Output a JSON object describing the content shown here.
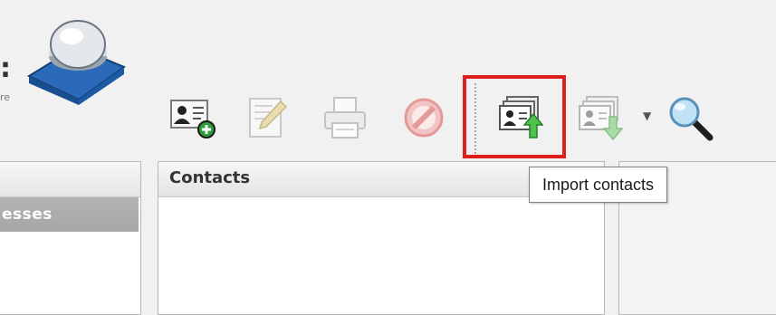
{
  "header": {
    "logo_text_fragment": ":",
    "logo_subtext_fragment": "re"
  },
  "toolbar": {
    "buttons": [
      {
        "name": "add-contact",
        "icon": "add-contact-icon",
        "enabled": true
      },
      {
        "name": "edit-contact",
        "icon": "pencil-icon",
        "enabled": false
      },
      {
        "name": "print-contact",
        "icon": "printer-icon",
        "enabled": false
      },
      {
        "name": "delete-contact",
        "icon": "delete-icon",
        "enabled": false
      },
      {
        "name": "import-contacts",
        "icon": "import-contacts-icon",
        "enabled": true,
        "highlighted": true
      },
      {
        "name": "export-contacts",
        "icon": "export-contacts-icon",
        "enabled": false,
        "has_dropdown": true
      },
      {
        "name": "search",
        "icon": "magnifier-icon",
        "enabled": true
      }
    ],
    "dropdown_caret": "▼"
  },
  "left_pane": {
    "selected_item_fragment": "esses"
  },
  "contacts_pane": {
    "title": "Contacts"
  },
  "tooltip": {
    "text": "Import contacts"
  },
  "colors": {
    "highlight": "#e01e1e",
    "selected_row": "#aaaaaa",
    "background": "#f1f1f1"
  }
}
